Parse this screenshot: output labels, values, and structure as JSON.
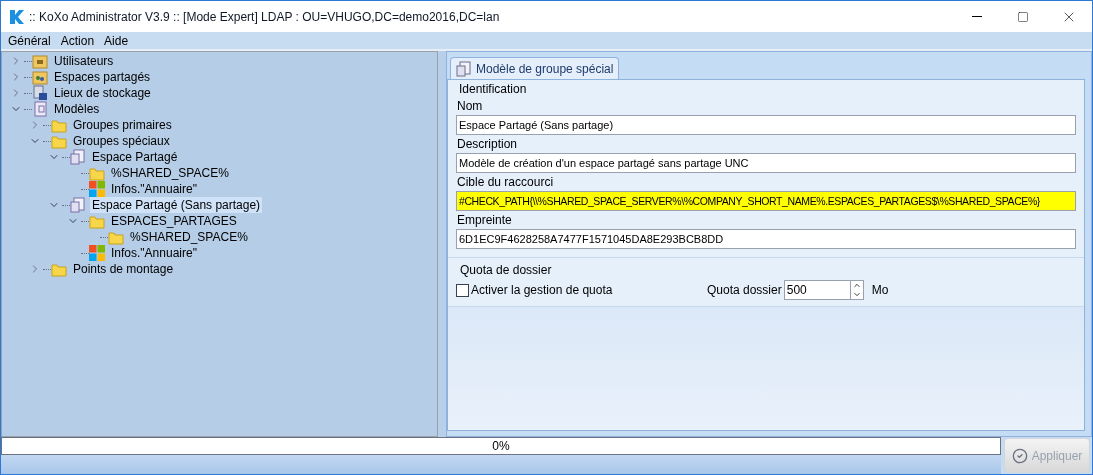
{
  "window": {
    "title": ":: KoXo Administrator V3.9 :: [Mode Expert] LDAP : OU=VHUGO,DC=demo2016,DC=lan"
  },
  "menu": [
    "Général",
    "Action",
    "Aide"
  ],
  "tree": [
    {
      "label": "Utilisateurs",
      "kind": "users",
      "expanded": false,
      "selected": false
    },
    {
      "label": "Espaces partagés",
      "kind": "share",
      "expanded": false,
      "selected": false
    },
    {
      "label": "Lieux de stockage",
      "kind": "storage",
      "expanded": false,
      "selected": false
    },
    {
      "label": "Modèles",
      "kind": "template",
      "expanded": true,
      "selected": false,
      "children": [
        {
          "label": "Groupes primaires",
          "kind": "folder",
          "expanded": false,
          "selected": false
        },
        {
          "label": "Groupes spéciaux",
          "kind": "folder",
          "expanded": true,
          "selected": false,
          "children": [
            {
              "label": "Espace Partagé",
              "kind": "document",
              "expanded": true,
              "selected": false,
              "children": [
                {
                  "label": "%SHARED_SPACE%",
                  "kind": "folder",
                  "selected": false
                },
                {
                  "label": "Infos.\"Annuaire\"",
                  "kind": "windows",
                  "selected": false
                }
              ]
            },
            {
              "label": "Espace Partagé (Sans partage)",
              "kind": "document",
              "expanded": true,
              "selected": true,
              "children": [
                {
                  "label": "ESPACES_PARTAGES",
                  "kind": "folder",
                  "expanded": true,
                  "selected": false,
                  "children": [
                    {
                      "label": "%SHARED_SPACE%",
                      "kind": "folder",
                      "selected": false
                    }
                  ]
                },
                {
                  "label": "Infos.\"Annuaire\"",
                  "kind": "windows",
                  "selected": false
                }
              ]
            }
          ]
        },
        {
          "label": "Points de montage",
          "kind": "folder",
          "expanded": false,
          "selected": false
        }
      ]
    }
  ],
  "tab": {
    "label": "Modèle de groupe spécial",
    "selected": true
  },
  "identification": {
    "title": "Identification",
    "fields": [
      {
        "label": "Nom",
        "value": "Espace Partagé (Sans partage)",
        "highlighted": false
      },
      {
        "label": "Description",
        "value": "Modèle de création d'un espace partagé sans partage UNC",
        "highlighted": false
      },
      {
        "label": "Cible du raccourci",
        "value": "#CHECK_PATH{\\\\%SHARED_SPACE_SERVER%\\%COMPANY_SHORT_NAME%.ESPACES_PARTAGES$\\%SHARED_SPACE%}",
        "highlighted": true
      },
      {
        "label": "Empreinte",
        "value": "6D1EC9F4628258A7477F1571045DA8E293BCB8DD",
        "highlighted": false
      }
    ]
  },
  "quota": {
    "title": "Quota de dossier",
    "checkbox": {
      "label": "Activer la gestion de quota",
      "checked": false
    },
    "field_label": "Quota dossier",
    "value": "500",
    "unit": "Mo"
  },
  "progress": {
    "text": "0%",
    "level": 0
  },
  "apply_button": {
    "label": "Appliquer",
    "disabled": true
  }
}
